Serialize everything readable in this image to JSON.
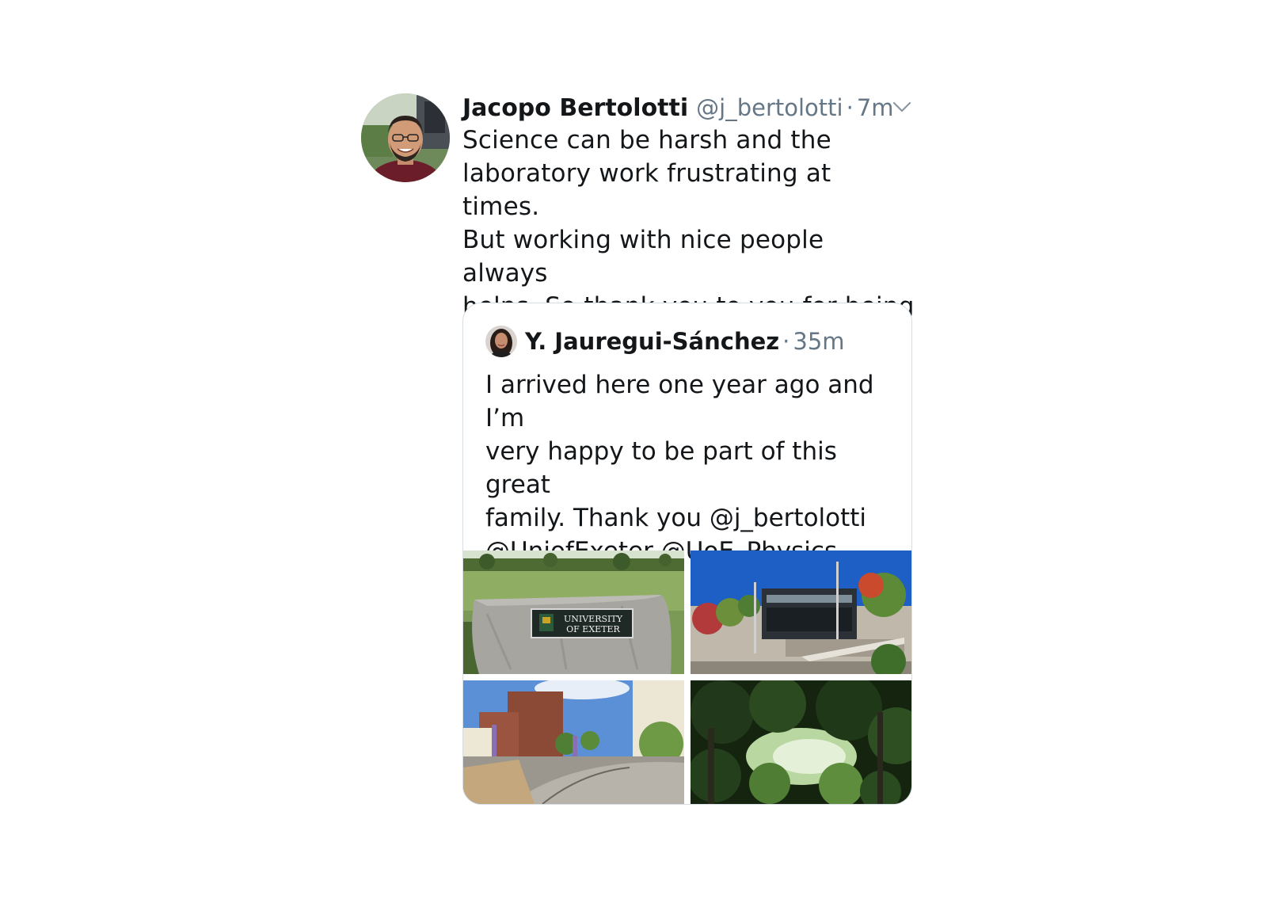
{
  "tweet": {
    "author_name": "Jacopo Bertolotti",
    "handle": "@j_bertolotti",
    "separator": "·",
    "time": "7m",
    "text": "Science can be harsh and the\nlaboratory work frustrating at times.\nBut working with nice people always\nhelps. So thank you to you for being\nyou",
    "emoji": "slightly-smiling-face-icon"
  },
  "quoted_tweet": {
    "author_name": "Y. Jauregui-Sánchez",
    "separator": "·",
    "time": "35m",
    "text": "I arrived here one year ago and I’m\nvery happy to be part of this great\nfamily. Thank you @j_bertolotti\n@UniofExeter  @UoE_Physics\n@Exeter_WiP",
    "photos": [
      {
        "name": "university-sign-photo",
        "sign_line1": "UNIVERSITY",
        "sign_line2": "OF EXETER"
      },
      {
        "name": "campus-building-photo"
      },
      {
        "name": "campus-path-photo"
      },
      {
        "name": "tree-canopy-photo"
      }
    ]
  },
  "colors": {
    "text": "#14171a",
    "secondary_text": "#657786",
    "border": "#d6dde3",
    "background": "#ffffff"
  }
}
